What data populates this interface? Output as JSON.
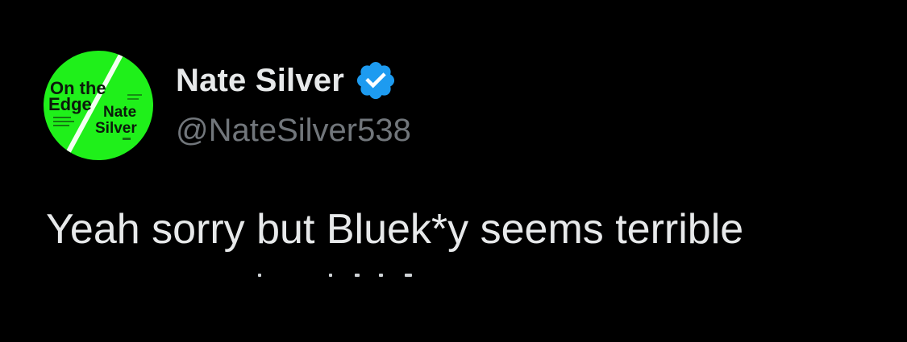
{
  "tweet": {
    "author": {
      "display_name": "Nate Silver",
      "handle": "@NateSilver538",
      "verified": true,
      "avatar": {
        "description_icon": "book-cover-avatar-icon",
        "cover_title_line1": "On the",
        "cover_title_line2": "Edge",
        "cover_author_line1": "Nate",
        "cover_author_line2": "Silver",
        "cover_color": "#1ff01a"
      }
    },
    "text": "Yeah sorry but Bluek*y seems terrible"
  },
  "colors": {
    "background": "#000000",
    "primary_text": "#e7e9ea",
    "secondary_text": "#71767b",
    "verified_blue": "#1d9bf0"
  }
}
